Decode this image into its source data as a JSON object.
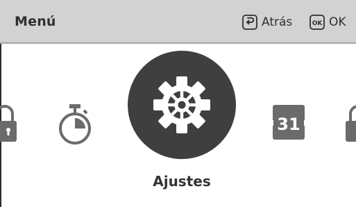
{
  "header": {
    "title": "Menú",
    "back_label": "Atrás",
    "ok_icon_text": "OK",
    "ok_label": "OK"
  },
  "menu": {
    "items": [
      {
        "icon": "lock-icon"
      },
      {
        "icon": "timer-icon"
      },
      {
        "icon": "gear-icon",
        "label": "Ajustes",
        "selected": true
      },
      {
        "icon": "calendar-icon",
        "text": "31"
      },
      {
        "icon": "lock-icon"
      }
    ],
    "selected_label": "Ajustes"
  },
  "colors": {
    "header_bg": "#d2d2d2",
    "header_border": "#a6a6a6",
    "icon_gray": "#6b6b6b",
    "selected_circle": "#3f3f3f",
    "text_dark": "#2f2f2f"
  }
}
